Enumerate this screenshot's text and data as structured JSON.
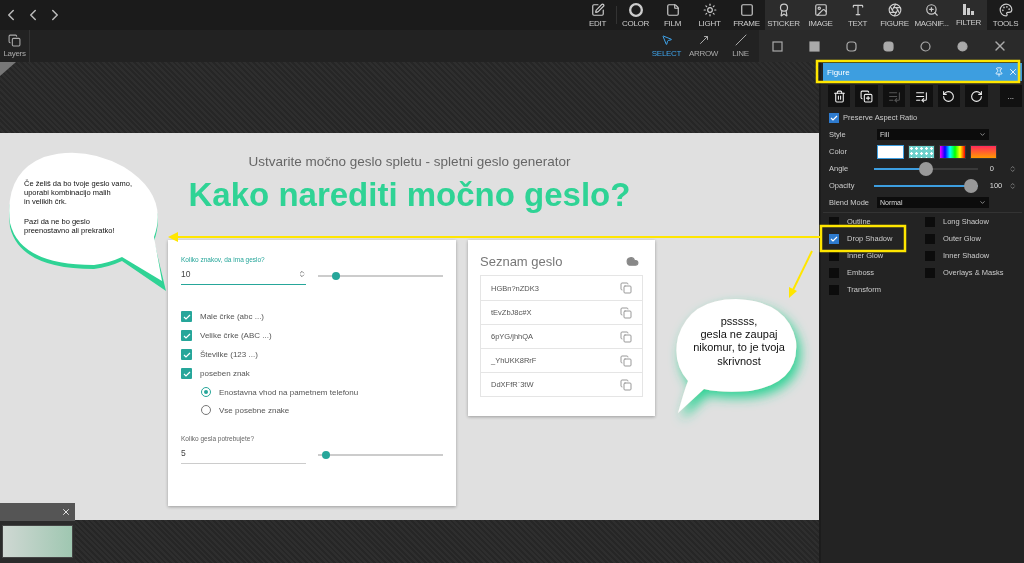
{
  "toolbar": {
    "main": [
      "EDIT",
      "COLOR",
      "FILM",
      "LIGHT",
      "FRAME"
    ],
    "tools": [
      "STICKER",
      "IMAGE",
      "TEXT",
      "FIGURE",
      "MAGNIF...",
      "FILTER"
    ],
    "end": [
      "TOOLS"
    ]
  },
  "subtoolbar": {
    "tools": [
      {
        "label": "SELECT",
        "selected": true
      },
      {
        "label": "ARROW",
        "selected": false
      },
      {
        "label": "LINE",
        "selected": false
      }
    ],
    "shapes": [
      {
        "kind": "square",
        "filled": false
      },
      {
        "kind": "square",
        "filled": true
      },
      {
        "kind": "rounded",
        "filled": false
      },
      {
        "kind": "rounded",
        "filled": true
      },
      {
        "kind": "circle",
        "filled": false
      },
      {
        "kind": "circle",
        "filled": true
      }
    ]
  },
  "layers_button": "Layers",
  "canvas": {
    "subtitle": "Ustvarite močno geslo spletu - spletni geslo generator",
    "title": "Kako narediti močno geslo?",
    "left_bubble": [
      "Če želiš da bo tvoje geslo vamo,\nuporabi kombinacijo malih\nin velikih črk.",
      "Pazi da ne bo geslo\npreenostavno ali prekratko!"
    ],
    "right_bubble": "psssss,\ngesla ne zaupaj\nnikomur, to je tvoja\nskrivnost",
    "form": {
      "length_label": "Koliko znakov, da ima geslo?",
      "length_value": "10",
      "length_slider": {
        "level": 0.12
      },
      "options": [
        {
          "label": "Male črke (abc ...)",
          "checked": true
        },
        {
          "label": "Velike črke (ABC ...)",
          "checked": true
        },
        {
          "label": "Številke (123 ...)",
          "checked": true
        },
        {
          "label": "poseben znak",
          "checked": true
        }
      ],
      "special": [
        {
          "label": "Enostavna vhod na pametnem telefonu",
          "selected": true
        },
        {
          "label": "Vse posebne znake",
          "selected": false
        }
      ],
      "count_label": "Koliko gesla potrebujete?",
      "count_value": "5",
      "count_slider": {
        "level": 0.03
      }
    },
    "list": {
      "title": "Seznam geslo",
      "passwords": [
        "HGBn?nZDK3",
        "tEvZbJ8c#X",
        "6pYG/jhhQA",
        "_YhUKK8RrF",
        "DdXFfR`3tW"
      ]
    }
  },
  "panel": {
    "title": "Figure",
    "more_label": "...",
    "actions": [
      {
        "kind": "delete",
        "disabled": false
      },
      {
        "kind": "duplicate",
        "disabled": false
      },
      {
        "kind": "align",
        "disabled": true
      },
      {
        "kind": "align",
        "disabled": false
      },
      {
        "kind": "rotate-left",
        "disabled": false
      },
      {
        "kind": "rotate-right",
        "disabled": false
      }
    ],
    "aspect": {
      "label": "Preserve Aspect Ratio",
      "checked": true
    },
    "style": {
      "label": "Style",
      "value": "Fill"
    },
    "color": {
      "label": "Color",
      "swatches": [
        {
          "kind": "solid",
          "selected": true
        },
        {
          "kind": "pattern",
          "selected": false
        },
        {
          "kind": "rainbow",
          "selected": false
        },
        {
          "kind": "gradient",
          "selected": false
        }
      ]
    },
    "angle": {
      "label": "Angle",
      "level": 0.5,
      "reading": "0"
    },
    "opacity": {
      "label": "Opacity",
      "level": 1,
      "reading": "100"
    },
    "blend": {
      "label": "Blend Mode",
      "value": "Normal"
    },
    "effects": [
      {
        "label": "Outline",
        "checked": false
      },
      {
        "label": "Long Shadow",
        "checked": false
      },
      {
        "label": "Drop Shadow",
        "checked": true
      },
      {
        "label": "Outer Glow",
        "checked": false
      },
      {
        "label": "Inner Glow",
        "checked": false
      },
      {
        "label": "Inner Shadow",
        "checked": false
      },
      {
        "label": "Emboss",
        "checked": false
      },
      {
        "label": "Overlays & Masks",
        "checked": false
      },
      {
        "label": "Transform",
        "checked": false
      }
    ]
  }
}
